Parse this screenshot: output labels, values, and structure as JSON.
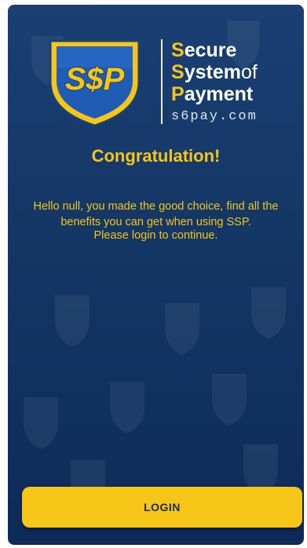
{
  "logo": {
    "badge_text": "S$P",
    "line1_cap": "S",
    "line1_rest": "ecure",
    "line2_cap": "S",
    "line2_rest": "ystem",
    "line2_suffix": "of",
    "line3_cap": "P",
    "line3_rest": "ayment",
    "domain": "s6pay.com"
  },
  "title": "Congratulation!",
  "message": "Hello null, you made the good choice, find all the benefits you can get when using SSP.",
  "prompt": "Please login to continue.",
  "login_button": "LOGIN",
  "colors": {
    "background": "#153766",
    "accent": "#f5c518",
    "button_text": "#1b2b45"
  }
}
